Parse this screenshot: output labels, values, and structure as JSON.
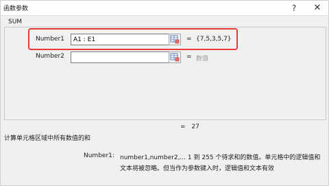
{
  "dialog": {
    "title": "函数参数",
    "help_glyph": "?",
    "close_glyph": "✕"
  },
  "function": {
    "name": "SUM",
    "args": [
      {
        "label": "Number1",
        "value": "A1 : E1",
        "result": "{7,5,3,5,7}",
        "result_muted": false
      },
      {
        "label": "Number2",
        "value": "",
        "result": "数值",
        "result_muted": true
      }
    ],
    "equals": "=",
    "formula_result": "27",
    "description": "计算单元格区域中所有数值的和",
    "param_help": {
      "name": "Number1:",
      "text": "number1,number2,... 1 到 255 个待求和的数值。单元格中的逻辑值和文本将被忽略。但当作为参数键入时，逻辑值和文本有效"
    }
  },
  "icons": {
    "ref_button": "range-select-icon"
  },
  "colors": {
    "highlight": "#e53935"
  }
}
